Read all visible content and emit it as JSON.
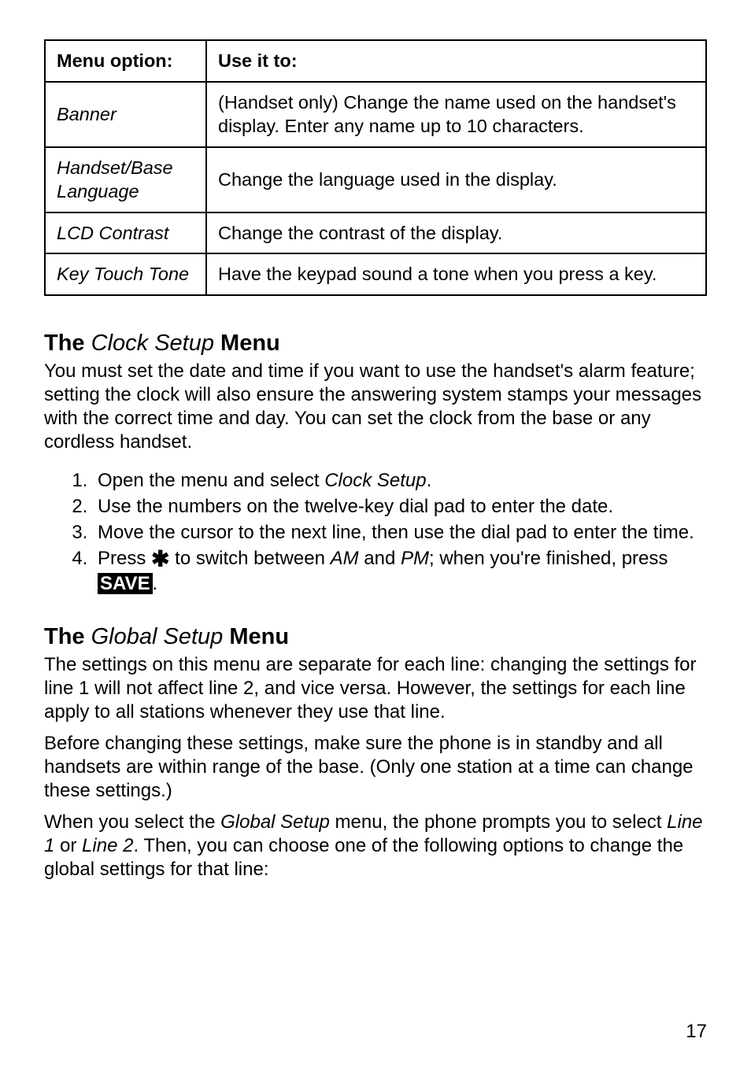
{
  "table": {
    "header_option": "Menu option:",
    "header_use": "Use it to:",
    "rows": [
      {
        "option": "Banner",
        "use": "(Handset only) Change the name used on the handset's display. Enter any name up to 10 characters."
      },
      {
        "option": "Handset/Base Language",
        "use": "Change the language used in the display."
      },
      {
        "option": "LCD Contrast",
        "use": "Change the contrast of the display."
      },
      {
        "option": "Key Touch Tone",
        "use": "Have the keypad sound a tone when you press a key."
      }
    ]
  },
  "clock_section": {
    "title_prefix": "The ",
    "title_italic": "Clock Setup",
    "title_suffix": " Menu",
    "intro": "You must set the date and time if you want to use the handset's alarm feature; setting the clock will also ensure the answering system stamps your messages with the correct time and day. You can set the clock from the base or any cordless handset.",
    "step1_a": "Open the menu and select ",
    "step1_b": "Clock Setup",
    "step1_c": ".",
    "step2": "Use the numbers on the twelve-key dial pad to enter the date.",
    "step3": "Move the cursor to the next line, then use the dial pad to enter the time.",
    "step4_a": "Press ",
    "step4_star": "✱",
    "step4_b": " to switch between ",
    "step4_am": "AM",
    "step4_c": " and ",
    "step4_pm": "PM",
    "step4_d": "; when you're finished, press ",
    "step4_save": "SAVE",
    "step4_e": "."
  },
  "global_section": {
    "title_prefix": "The ",
    "title_italic": "Global Setup",
    "title_suffix": " Menu",
    "p1": "The settings on this menu are separate for each line: changing the settings for line 1 will not affect line 2, and vice versa. However, the settings for each line apply to all stations whenever they use that line.",
    "p2": "Before changing these settings, make sure the phone is in standby and all handsets are within range of the base. (Only one station at a time can change these settings.)",
    "p3_a": "When you select the ",
    "p3_b": "Global Setup",
    "p3_c": " menu, the phone prompts you to select ",
    "p3_d": "Line 1",
    "p3_e": " or ",
    "p3_f": "Line 2",
    "p3_g": ". Then, you can choose one of the following options to change the global settings for that line:"
  },
  "page_number": "17"
}
